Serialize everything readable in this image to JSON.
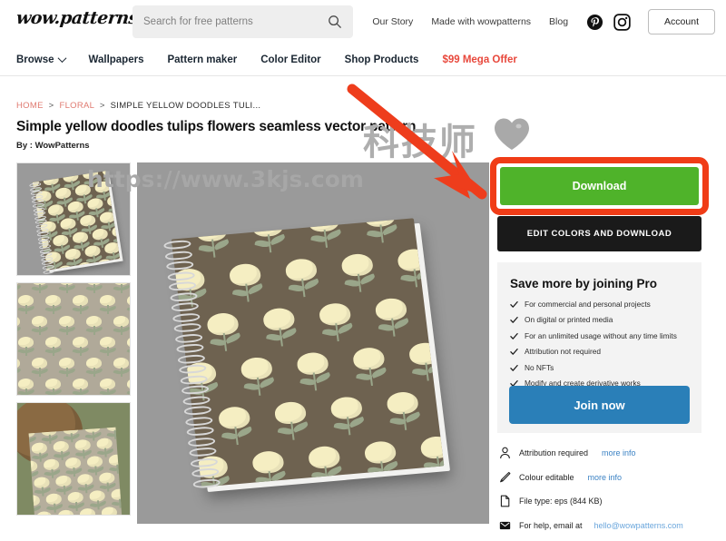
{
  "site": {
    "logo_text": "wow.patterns"
  },
  "search": {
    "placeholder": "Search for free patterns",
    "value": "",
    "icon": "search-icon"
  },
  "topnav": {
    "links": [
      {
        "label": "Our Story"
      },
      {
        "label": "Made with wowpatterns"
      },
      {
        "label": "Blog"
      }
    ],
    "social": [
      {
        "name": "pinterest-icon"
      },
      {
        "name": "instagram-icon"
      }
    ],
    "account_label": "Account"
  },
  "mainnav": {
    "items": [
      {
        "label": "Browse",
        "has_chevron": true
      },
      {
        "label": "Wallpapers",
        "has_chevron": false
      },
      {
        "label": "Pattern maker",
        "has_chevron": false
      },
      {
        "label": "Color Editor",
        "has_chevron": false
      },
      {
        "label": "Shop Products",
        "has_chevron": false
      },
      {
        "label": "$99 Mega Offer",
        "has_chevron": false,
        "accent": "#e8483c"
      }
    ]
  },
  "breadcrumb": {
    "home": "HOME",
    "category": "FLORAL",
    "current": "SIMPLE YELLOW DOODLES TULI...",
    "separator": ">"
  },
  "product": {
    "title": "Simple yellow doodles tulips flowers seamless vector pattern",
    "byline": "By : WowPatterns",
    "thumbnails": [
      {
        "alt": "spiral notebook mockup with yellow tulip pattern"
      },
      {
        "alt": "flat yellow tulip seamless pattern swatch"
      },
      {
        "alt": "fabric on basket outdoors with tulip pattern"
      }
    ],
    "main_image_alt": "spiral notebook mockup with yellow tulip seamless pattern on brown cover"
  },
  "watermark": {
    "cjk": "科技师",
    "heart": "heart-icon",
    "url": "https://www.3kjs.com"
  },
  "annotation": {
    "arrow_color": "#ee3d1c",
    "highlight_color": "#f03c17",
    "target": "download-button"
  },
  "actions": {
    "download_label": "Download",
    "download_color": "#4fb32a",
    "edit_label": "EDIT COLORS AND DOWNLOAD",
    "edit_color": "#1a1a1a"
  },
  "pro": {
    "title": "Save more by joining Pro",
    "features": [
      "For commercial and personal projects",
      "On digital or printed media",
      "For an unlimited usage without any time limits",
      "Attribution not required",
      "No NFTs",
      "Modify and create derivative works"
    ],
    "join_label": "Join now",
    "join_color": "#2a7fb8"
  },
  "info": [
    {
      "icon": "person-icon",
      "text": "Attribution required",
      "link": "more info"
    },
    {
      "icon": "pencil-icon",
      "text": "Colour editable",
      "link": "more info"
    },
    {
      "icon": "file-icon",
      "text": "File type: eps (844 KB)",
      "link": ""
    },
    {
      "icon": "envelope-icon",
      "text": "For help, email at",
      "link": "hello@wowpatterns.com"
    }
  ]
}
